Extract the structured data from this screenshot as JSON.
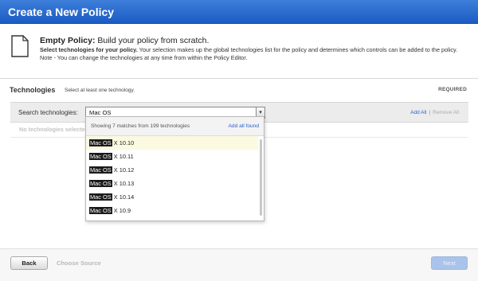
{
  "window": {
    "title": "Create a New Policy"
  },
  "header": {
    "icon": "document-icon",
    "title_bold": "Empty Policy:",
    "title_rest": " Build your policy from scratch.",
    "desc_bold": "Select technologies for your policy.",
    "desc_rest": " Your selection makes up the global technologies list for the policy and determines which controls can be added to the policy. Note - You can change the technologies at any time from within the Policy Editor."
  },
  "technologies": {
    "title": "Technologies",
    "subtitle": "Select at least one technology.",
    "required": "REQUIRED",
    "search_label": "Search technologies:",
    "search_value": "Mac OS",
    "add_all": "Add All",
    "separator": "|",
    "remove_all": "Remove All",
    "empty_text": "No technologies selected"
  },
  "dropdown": {
    "count_text": "Showing 7 matches from 199 technologies",
    "add_all_found": "Add all found",
    "highlight": "Mac OS",
    "items": [
      {
        "rest": " X 10.10"
      },
      {
        "rest": " X 10.11"
      },
      {
        "rest": " X 10.12"
      },
      {
        "rest": " X 10.13"
      },
      {
        "rest": " X 10.14"
      },
      {
        "rest": " X 10.9"
      }
    ]
  },
  "footer": {
    "back": "Back",
    "choose_source": "Choose Source",
    "next": "Next"
  },
  "colors": {
    "title_bar": "#1b5bc4",
    "link": "#2a62c9",
    "next_disabled": "#a9c3eb"
  }
}
